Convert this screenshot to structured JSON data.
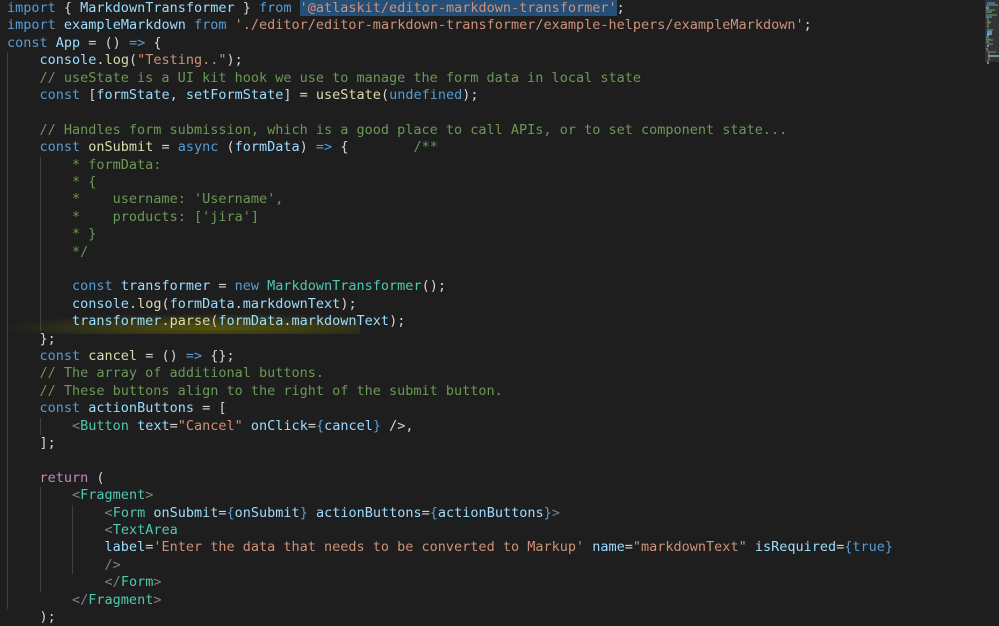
{
  "theme": {
    "background": "#1e1e1e",
    "colors": {
      "kw": "#569cd6",
      "ctl": "#c586c0",
      "fn": "#dcdcaa",
      "var": "#9cdcfe",
      "cls": "#4ec9b0",
      "str": "#ce9178",
      "cmt": "#6a9955",
      "tag": "#808080",
      "txt": "#d4d4d4"
    }
  },
  "editor": {
    "lines": [
      [
        [
          "kw",
          "import"
        ],
        [
          "txt",
          " { "
        ],
        [
          "var",
          "MarkdownTransformer"
        ],
        [
          "txt",
          " } "
        ],
        [
          "kw",
          "from"
        ],
        [
          "txt",
          " "
        ],
        [
          "str",
          "'@atlaskit/editor-markdown-transformer'"
        ],
        [
          "txt",
          ";"
        ]
      ],
      [
        [
          "kw",
          "import"
        ],
        [
          "txt",
          " "
        ],
        [
          "var",
          "exampleMarkdown"
        ],
        [
          "txt",
          " "
        ],
        [
          "kw",
          "from"
        ],
        [
          "txt",
          " "
        ],
        [
          "str",
          "'./editor/editor-markdown-transformer/example-helpers/exampleMarkdown'"
        ],
        [
          "txt",
          ";"
        ]
      ],
      [
        [
          "kw",
          "const"
        ],
        [
          "txt",
          " "
        ],
        [
          "var",
          "App"
        ],
        [
          "txt",
          " = () "
        ],
        [
          "kw",
          "=>"
        ],
        [
          "txt",
          " {"
        ]
      ],
      [
        [
          "txt",
          "    "
        ],
        [
          "var",
          "console"
        ],
        [
          "txt",
          "."
        ],
        [
          "fn",
          "log"
        ],
        [
          "txt",
          "("
        ],
        [
          "str",
          "\"Testing..\""
        ],
        [
          "txt",
          ");"
        ]
      ],
      [
        [
          "txt",
          "    "
        ],
        [
          "cmt",
          "// useState is a UI kit hook we use to manage the form data in local state"
        ]
      ],
      [
        [
          "txt",
          "    "
        ],
        [
          "kw",
          "const"
        ],
        [
          "txt",
          " ["
        ],
        [
          "var",
          "formState"
        ],
        [
          "txt",
          ", "
        ],
        [
          "var",
          "setFormState"
        ],
        [
          "txt",
          "] = "
        ],
        [
          "fn",
          "useState"
        ],
        [
          "txt",
          "("
        ],
        [
          "kw",
          "undefined"
        ],
        [
          "txt",
          ");"
        ]
      ],
      [
        [
          "txt",
          ""
        ]
      ],
      [
        [
          "txt",
          "    "
        ],
        [
          "cmt",
          "// Handles form submission, which is a good place to call APIs, or to set component state..."
        ]
      ],
      [
        [
          "txt",
          "    "
        ],
        [
          "kw",
          "const"
        ],
        [
          "txt",
          " "
        ],
        [
          "fn",
          "onSubmit"
        ],
        [
          "txt",
          " = "
        ],
        [
          "kw",
          "async"
        ],
        [
          "txt",
          " ("
        ],
        [
          "var",
          "formData"
        ],
        [
          "txt",
          ") "
        ],
        [
          "kw",
          "=>"
        ],
        [
          "txt",
          " {        "
        ],
        [
          "cmt",
          "/**"
        ]
      ],
      [
        [
          "txt",
          "        "
        ],
        [
          "cmt",
          "* formData:"
        ]
      ],
      [
        [
          "txt",
          "        "
        ],
        [
          "cmt",
          "* {"
        ]
      ],
      [
        [
          "txt",
          "        "
        ],
        [
          "cmt",
          "*    username: 'Username',"
        ]
      ],
      [
        [
          "txt",
          "        "
        ],
        [
          "cmt",
          "*    products: ['jira']"
        ]
      ],
      [
        [
          "txt",
          "        "
        ],
        [
          "cmt",
          "* }"
        ]
      ],
      [
        [
          "txt",
          "        "
        ],
        [
          "cmt",
          "*/"
        ]
      ],
      [
        [
          "txt",
          ""
        ]
      ],
      [
        [
          "txt",
          "        "
        ],
        [
          "kw",
          "const"
        ],
        [
          "txt",
          " "
        ],
        [
          "var",
          "transformer"
        ],
        [
          "txt",
          " = "
        ],
        [
          "kw",
          "new"
        ],
        [
          "txt",
          " "
        ],
        [
          "cls",
          "MarkdownTransformer"
        ],
        [
          "txt",
          "();"
        ]
      ],
      [
        [
          "txt",
          "        "
        ],
        [
          "var",
          "console"
        ],
        [
          "txt",
          "."
        ],
        [
          "fn",
          "log"
        ],
        [
          "txt",
          "("
        ],
        [
          "var",
          "formData"
        ],
        [
          "txt",
          "."
        ],
        [
          "var",
          "markdownText"
        ],
        [
          "txt",
          ");"
        ]
      ],
      [
        [
          "txt",
          "        "
        ],
        [
          "var",
          "transformer"
        ],
        [
          "txt",
          "."
        ],
        [
          "fn",
          "parse"
        ],
        [
          "txt",
          "("
        ],
        [
          "var",
          "formData"
        ],
        [
          "txt",
          "."
        ],
        [
          "var",
          "markdownText"
        ],
        [
          "txt",
          ");"
        ]
      ],
      [
        [
          "txt",
          "    };"
        ]
      ],
      [
        [
          "txt",
          "    "
        ],
        [
          "kw",
          "const"
        ],
        [
          "txt",
          " "
        ],
        [
          "fn",
          "cancel"
        ],
        [
          "txt",
          " = () "
        ],
        [
          "kw",
          "=>"
        ],
        [
          "txt",
          " {};"
        ]
      ],
      [
        [
          "txt",
          "    "
        ],
        [
          "cmt",
          "// The array of additional buttons."
        ]
      ],
      [
        [
          "txt",
          "    "
        ],
        [
          "cmt",
          "// These buttons align to the right of the submit button."
        ]
      ],
      [
        [
          "txt",
          "    "
        ],
        [
          "kw",
          "const"
        ],
        [
          "txt",
          " "
        ],
        [
          "var",
          "actionButtons"
        ],
        [
          "txt",
          " = ["
        ]
      ],
      [
        [
          "txt",
          "        "
        ],
        [
          "tag",
          "<"
        ],
        [
          "cls",
          "Button"
        ],
        [
          "txt",
          " "
        ],
        [
          "var",
          "text"
        ],
        [
          "txt",
          "="
        ],
        [
          "str",
          "\"Cancel\""
        ],
        [
          "txt",
          " "
        ],
        [
          "var",
          "onClick"
        ],
        [
          "txt",
          "="
        ],
        [
          "kw",
          "{"
        ],
        [
          "var",
          "cancel"
        ],
        [
          "kw",
          "}"
        ],
        [
          "txt",
          " />,"
        ]
      ],
      [
        [
          "txt",
          "    ];"
        ]
      ],
      [
        [
          "txt",
          ""
        ]
      ],
      [
        [
          "txt",
          "    "
        ],
        [
          "ctl",
          "return"
        ],
        [
          "txt",
          " ("
        ]
      ],
      [
        [
          "txt",
          "        "
        ],
        [
          "tag",
          "<"
        ],
        [
          "cls",
          "Fragment"
        ],
        [
          "tag",
          ">"
        ]
      ],
      [
        [
          "txt",
          "            "
        ],
        [
          "tag",
          "<"
        ],
        [
          "cls",
          "Form"
        ],
        [
          "txt",
          " "
        ],
        [
          "var",
          "onSubmit"
        ],
        [
          "txt",
          "="
        ],
        [
          "kw",
          "{"
        ],
        [
          "var",
          "onSubmit"
        ],
        [
          "kw",
          "}"
        ],
        [
          "txt",
          " "
        ],
        [
          "var",
          "actionButtons"
        ],
        [
          "txt",
          "="
        ],
        [
          "kw",
          "{"
        ],
        [
          "var",
          "actionButtons"
        ],
        [
          "kw",
          "}"
        ],
        [
          "tag",
          ">"
        ]
      ],
      [
        [
          "txt",
          "            "
        ],
        [
          "tag",
          "<"
        ],
        [
          "cls",
          "TextArea"
        ]
      ],
      [
        [
          "txt",
          "            "
        ],
        [
          "var",
          "label"
        ],
        [
          "txt",
          "="
        ],
        [
          "str",
          "'Enter the data that needs to be converted to Markup'"
        ],
        [
          "txt",
          " "
        ],
        [
          "var",
          "name"
        ],
        [
          "txt",
          "="
        ],
        [
          "str",
          "\"markdownText\""
        ],
        [
          "txt",
          " "
        ],
        [
          "var",
          "isRequired"
        ],
        [
          "txt",
          "="
        ],
        [
          "kw",
          "{"
        ],
        [
          "kw",
          "true"
        ],
        [
          "kw",
          "}"
        ]
      ],
      [
        [
          "txt",
          "            "
        ],
        [
          "tag",
          "/>"
        ]
      ],
      [
        [
          "txt",
          "            "
        ],
        [
          "tag",
          "</"
        ],
        [
          "cls",
          "Form"
        ],
        [
          "tag",
          ">"
        ]
      ],
      [
        [
          "txt",
          "        "
        ],
        [
          "tag",
          "</"
        ],
        [
          "cls",
          "Fragment"
        ],
        [
          "tag",
          ">"
        ]
      ],
      [
        [
          "txt",
          "    );"
        ]
      ]
    ]
  }
}
